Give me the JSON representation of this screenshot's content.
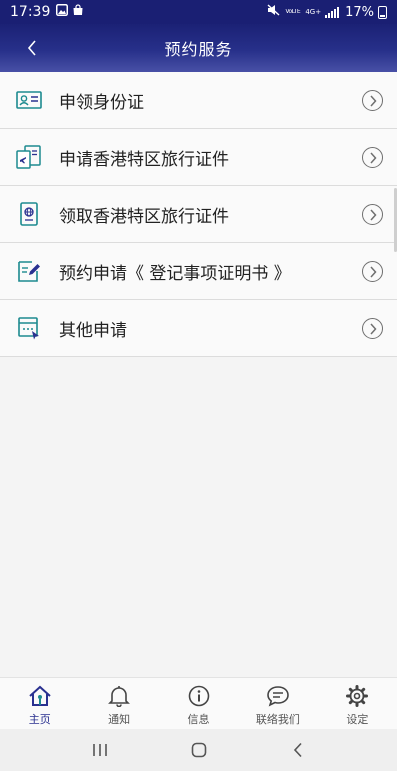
{
  "status_bar": {
    "time": "17:39",
    "battery": "17%",
    "volte_label": "VoLTE",
    "network_label": "4G+"
  },
  "header": {
    "title": "预约服务"
  },
  "menu": {
    "items": [
      {
        "label": "申领身份证",
        "icon": "id-card-icon"
      },
      {
        "label": "申请香港特区旅行证件",
        "icon": "travel-document-apply-icon"
      },
      {
        "label": "领取香港特区旅行证件",
        "icon": "passport-icon"
      },
      {
        "label": "预约申请《 登记事项证明书 》",
        "icon": "certificate-edit-icon"
      },
      {
        "label": "其他申请",
        "icon": "other-application-icon"
      }
    ]
  },
  "tabbar": {
    "items": [
      {
        "label": "主页",
        "icon": "home-icon",
        "active": true
      },
      {
        "label": "通知",
        "icon": "bell-icon",
        "active": false
      },
      {
        "label": "信息",
        "icon": "info-icon",
        "active": false
      },
      {
        "label": "联络我们",
        "icon": "chat-icon",
        "active": false
      },
      {
        "label": "设定",
        "icon": "gear-icon",
        "active": false
      }
    ]
  },
  "colors": {
    "header": "#1b2175",
    "accent": "#2a3190",
    "icon_teal": "#1c8a8f"
  }
}
